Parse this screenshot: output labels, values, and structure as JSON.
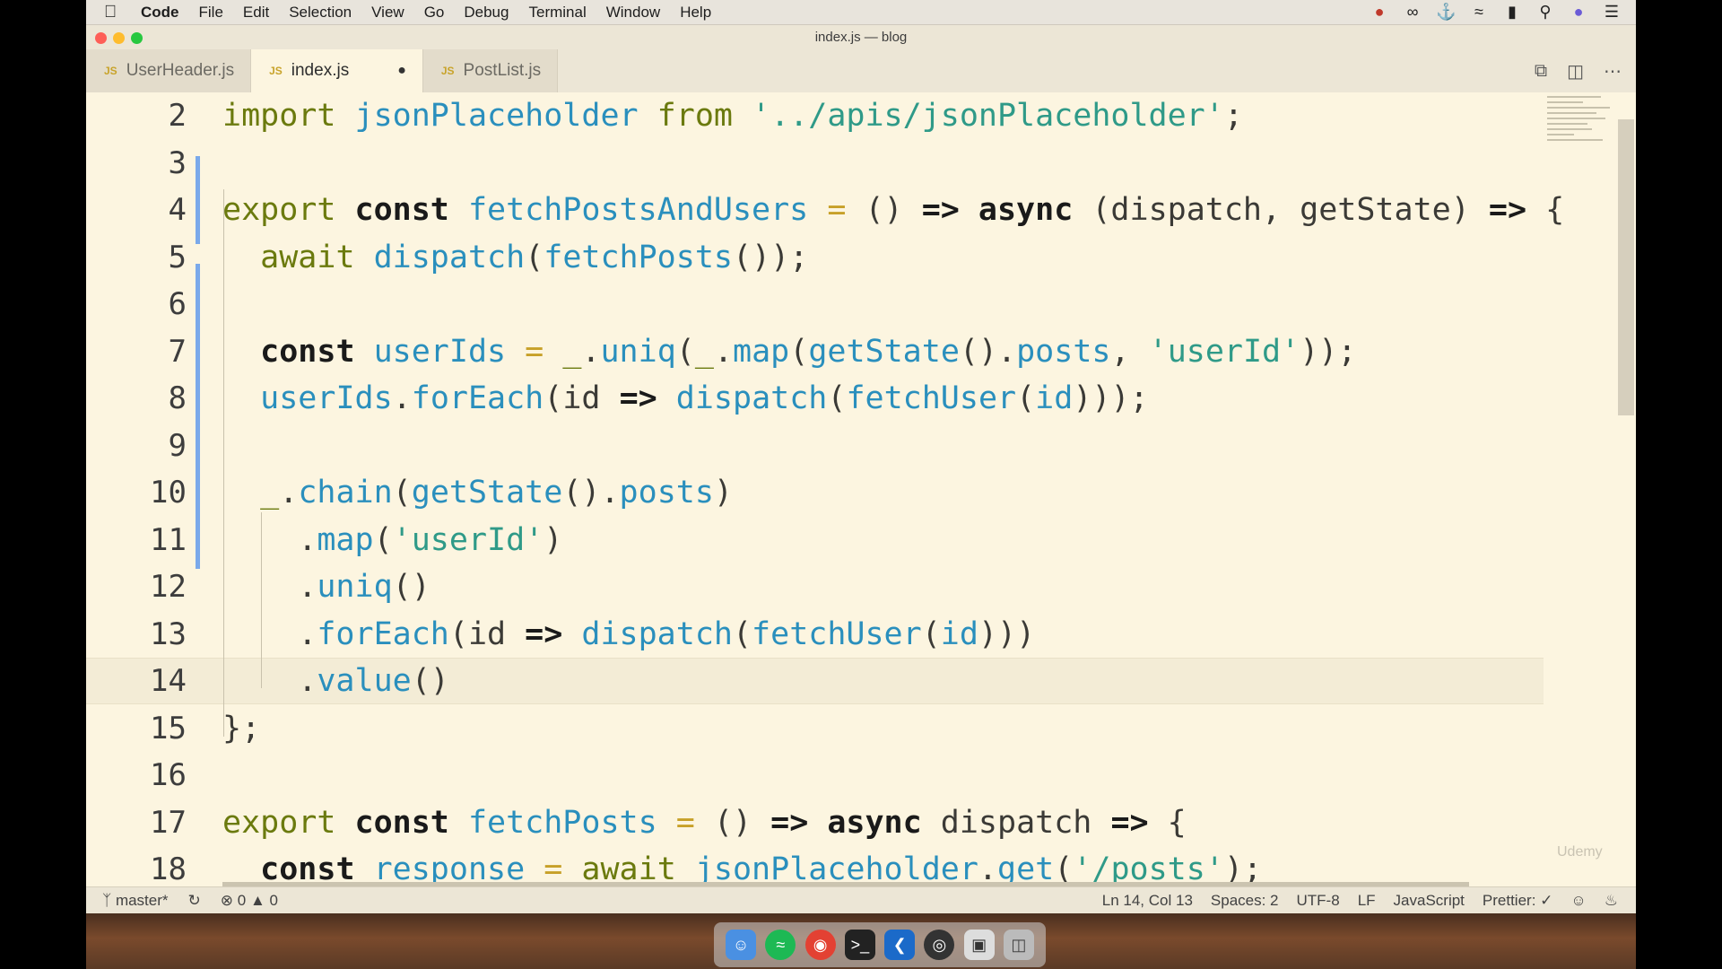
{
  "menubar": {
    "apple_icon": "apple-icon",
    "items": [
      "Code",
      "File",
      "Edit",
      "Selection",
      "View",
      "Go",
      "Debug",
      "Terminal",
      "Window",
      "Help"
    ],
    "status_icons": [
      "creative-cloud-icon",
      "glasses-icon",
      "docker-icon",
      "wifi-icon",
      "battery-icon",
      "search-icon",
      "siri-icon",
      "list-icon"
    ]
  },
  "window": {
    "title": "index.js — blog"
  },
  "tabs": [
    {
      "label": "UserHeader.js",
      "prefix": "JS"
    },
    {
      "label": "index.js",
      "prefix": "JS",
      "modified_marker": "●"
    },
    {
      "label": "PostList.js",
      "prefix": "JS"
    }
  ],
  "editor": {
    "lines": [
      {
        "n": "2",
        "tokens": [
          [
            "kw",
            "import "
          ],
          [
            "fn",
            "jsonPlaceholder "
          ],
          [
            "kw",
            "from "
          ],
          [
            "str",
            "'../apis/jsonPlaceholder'"
          ],
          [
            "pn",
            ";"
          ]
        ]
      },
      {
        "n": "3",
        "tokens": []
      },
      {
        "n": "4",
        "tokens": [
          [
            "kw",
            "export "
          ],
          [
            "kwb",
            "const "
          ],
          [
            "fn",
            "fetchPostsAndUsers "
          ],
          [
            "op",
            "= "
          ],
          [
            "pn",
            "() "
          ],
          [
            "kwb",
            "=> async "
          ],
          [
            "pn",
            "(dispatch, getState) "
          ],
          [
            "kwb",
            "=> "
          ],
          [
            "pn",
            "{"
          ]
        ]
      },
      {
        "n": "5",
        "tokens": [
          [
            "pn",
            "  "
          ],
          [
            "kw",
            "await "
          ],
          [
            "fn",
            "dispatch"
          ],
          [
            "pn",
            "("
          ],
          [
            "fn",
            "fetchPosts"
          ],
          [
            "pn",
            "());"
          ]
        ]
      },
      {
        "n": "6",
        "tokens": []
      },
      {
        "n": "7",
        "tokens": [
          [
            "pn",
            "  "
          ],
          [
            "kwb",
            "const "
          ],
          [
            "fn",
            "userIds "
          ],
          [
            "op",
            "= "
          ],
          [
            "kw",
            "_"
          ],
          [
            "pn",
            "."
          ],
          [
            "fn",
            "uniq"
          ],
          [
            "pn",
            "("
          ],
          [
            "kw",
            "_"
          ],
          [
            "pn",
            "."
          ],
          [
            "fn",
            "map"
          ],
          [
            "pn",
            "("
          ],
          [
            "fn",
            "getState"
          ],
          [
            "pn",
            "()."
          ],
          [
            "fn",
            "posts"
          ],
          [
            "pn",
            ", "
          ],
          [
            "str",
            "'userId'"
          ],
          [
            "pn",
            "));"
          ]
        ]
      },
      {
        "n": "8",
        "tokens": [
          [
            "pn",
            "  "
          ],
          [
            "fn",
            "userIds"
          ],
          [
            "pn",
            "."
          ],
          [
            "fn",
            "forEach"
          ],
          [
            "pn",
            "(id "
          ],
          [
            "kwb",
            "=> "
          ],
          [
            "fn",
            "dispatch"
          ],
          [
            "pn",
            "("
          ],
          [
            "fn",
            "fetchUser"
          ],
          [
            "pn",
            "("
          ],
          [
            "fn",
            "id"
          ],
          [
            "pn",
            ")));"
          ]
        ]
      },
      {
        "n": "9",
        "tokens": []
      },
      {
        "n": "10",
        "tokens": [
          [
            "pn",
            "  "
          ],
          [
            "kw",
            "_"
          ],
          [
            "pn",
            "."
          ],
          [
            "fn",
            "chain"
          ],
          [
            "pn",
            "("
          ],
          [
            "fn",
            "getState"
          ],
          [
            "pn",
            "()."
          ],
          [
            "fn",
            "posts"
          ],
          [
            "pn",
            ")"
          ]
        ]
      },
      {
        "n": "11",
        "tokens": [
          [
            "pn",
            "    ."
          ],
          [
            "fn",
            "map"
          ],
          [
            "pn",
            "("
          ],
          [
            "str",
            "'userId'"
          ],
          [
            "pn",
            ")"
          ]
        ]
      },
      {
        "n": "12",
        "tokens": [
          [
            "pn",
            "    ."
          ],
          [
            "fn",
            "uniq"
          ],
          [
            "pn",
            "()"
          ]
        ]
      },
      {
        "n": "13",
        "tokens": [
          [
            "pn",
            "    ."
          ],
          [
            "fn",
            "forEach"
          ],
          [
            "pn",
            "(id "
          ],
          [
            "kwb",
            "=> "
          ],
          [
            "fn",
            "dispatch"
          ],
          [
            "pn",
            "("
          ],
          [
            "fn",
            "fetchUser"
          ],
          [
            "pn",
            "("
          ],
          [
            "fn",
            "id"
          ],
          [
            "pn",
            ")))"
          ]
        ]
      },
      {
        "n": "14",
        "tokens": [
          [
            "pn",
            "    ."
          ],
          [
            "fn",
            "value"
          ],
          [
            "pn",
            "()"
          ]
        ]
      },
      {
        "n": "15",
        "tokens": [
          [
            "pn",
            "};"
          ]
        ]
      },
      {
        "n": "16",
        "tokens": []
      },
      {
        "n": "17",
        "tokens": [
          [
            "kw",
            "export "
          ],
          [
            "kwb",
            "const "
          ],
          [
            "fn",
            "fetchPosts "
          ],
          [
            "op",
            "= "
          ],
          [
            "pn",
            "() "
          ],
          [
            "kwb",
            "=> async "
          ],
          [
            "pn",
            "dispatch "
          ],
          [
            "kwb",
            "=> "
          ],
          [
            "pn",
            "{"
          ]
        ]
      },
      {
        "n": "18",
        "tokens": [
          [
            "pn",
            "  "
          ],
          [
            "kwb",
            "const "
          ],
          [
            "fn",
            "response "
          ],
          [
            "op",
            "= "
          ],
          [
            "kw",
            "await "
          ],
          [
            "fn",
            "jsonPlaceholder"
          ],
          [
            "pn",
            "."
          ],
          [
            "fn",
            "get"
          ],
          [
            "pn",
            "("
          ],
          [
            "str",
            "'/posts'"
          ],
          [
            "pn",
            ");"
          ]
        ]
      }
    ],
    "current_line": "14",
    "watermark": "Udemy"
  },
  "statusbar": {
    "branch": "master*",
    "errors": "0",
    "warnings": "0",
    "position": "Ln 14, Col 13",
    "spaces": "Spaces: 2",
    "encoding": "UTF-8",
    "eol": "LF",
    "language": "JavaScript",
    "formatter": "Prettier: ✓"
  },
  "dock": [
    "finder-icon",
    "spotify-icon",
    "chrome-icon",
    "terminal-icon",
    "vscode-icon",
    "obs-icon",
    "preview-icon",
    "trash-icon"
  ]
}
